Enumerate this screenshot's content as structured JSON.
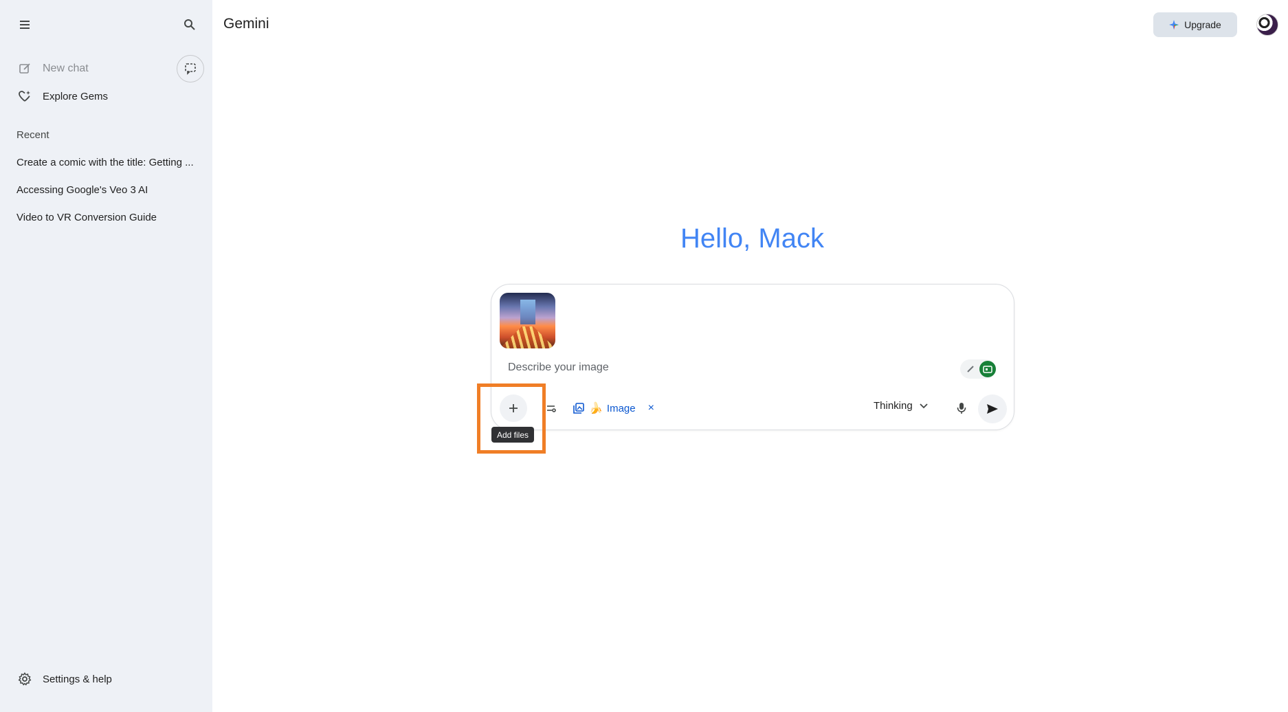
{
  "app": {
    "title": "Gemini"
  },
  "sidebar": {
    "new_chat_label": "New chat",
    "explore_label": "Explore Gems",
    "recent_label": "Recent",
    "recent_items": [
      "Create a comic with the title: Getting ...",
      "Accessing Google's Veo 3 AI",
      "Video to VR Conversion Guide"
    ],
    "settings_label": "Settings & help"
  },
  "header": {
    "upgrade_label": "Upgrade"
  },
  "main": {
    "greeting": "Hello, Mack"
  },
  "composer": {
    "placeholder": "Describe your image",
    "tool_chip_label": "Image",
    "tool_chip_close": "×",
    "model_label": "Thinking",
    "add_files_tooltip": "Add files"
  },
  "colors": {
    "sidebar_bg": "#eef1f6",
    "greeting": "#4285f4",
    "chip": "#0b57d0",
    "highlight": "#f07e26"
  }
}
